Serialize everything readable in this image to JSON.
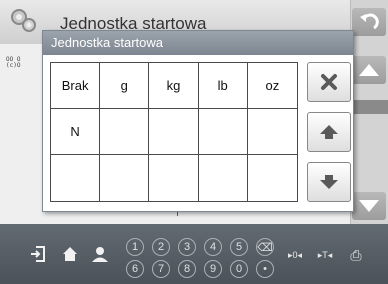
{
  "background": {
    "title": "Jednostka startowa",
    "tiny_label_line1": "OO O",
    "tiny_label_line2": "(c)O"
  },
  "dialog": {
    "title": "Jednostka startowa",
    "cells": [
      "Brak",
      "g",
      "kg",
      "lb",
      "oz",
      "N",
      "",
      "",
      "",
      "",
      "",
      "",
      "",
      "",
      ""
    ]
  },
  "icons": {
    "dialog_buttons": [
      "close-icon",
      "arrow-up-icon",
      "arrow-down-icon"
    ],
    "background_side": [
      "undo-icon",
      "arrow-up-icon",
      "arrow-down-icon"
    ]
  },
  "bottom_bar": {
    "icons": [
      "logout-icon",
      "home-icon",
      "user-icon"
    ],
    "keypad_row1": [
      "1",
      "2",
      "3",
      "4",
      "5"
    ],
    "keypad_row2": [
      "6",
      "7",
      "8",
      "9",
      "0"
    ],
    "backspace": "⌫",
    "decimal": "•",
    "zero_label": "▸0◂",
    "tare_label": "▸T◂",
    "print_label": "⎙"
  },
  "colors": {
    "dialog_title_bg": "#8a929b",
    "bottom_bar_bg": "#555c63"
  }
}
